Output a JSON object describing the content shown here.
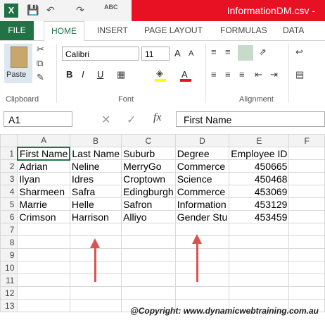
{
  "window": {
    "title": "InformationDM.csv - "
  },
  "qat": {
    "save_icon": "save-icon",
    "undo_icon": "undo-icon",
    "redo_icon": "redo-icon",
    "spell_icon": "spellcheck-icon",
    "spell_label": "ABC"
  },
  "tabs": [
    "FILE",
    "HOME",
    "INSERT",
    "PAGE LAYOUT",
    "FORMULAS",
    "DATA"
  ],
  "ribbon": {
    "clipboard": {
      "paste_label": "Paste",
      "group_label": "Clipboard"
    },
    "font": {
      "name": "Calibri",
      "size": "11",
      "group_label": "Font",
      "bold": "B",
      "italic": "I",
      "underline": "U",
      "grow": "A",
      "shrink": "A"
    },
    "alignment": {
      "group_label": "Alignment"
    }
  },
  "formula_bar": {
    "name_box": "A1",
    "value": "First Name",
    "fx_label": "fx"
  },
  "sheet": {
    "columns": [
      "A",
      "B",
      "C",
      "D",
      "E",
      "F"
    ],
    "rows": [
      [
        "First Name",
        "Last Name",
        "Suburb",
        "Degree",
        "Employee ID",
        ""
      ],
      [
        "Adrian",
        "Neline",
        "MerryGo",
        "Commerce",
        "450665",
        ""
      ],
      [
        "Ilyan",
        "Idres",
        "Croptown",
        "Science",
        "450468",
        ""
      ],
      [
        "Sharmeen",
        "Safra",
        "Edingburgh",
        "Commerce",
        "453069",
        ""
      ],
      [
        "Marrie",
        "Helle",
        "Safron",
        "Information",
        "453129",
        ""
      ],
      [
        "Crimson",
        "Harrison",
        "Alliyo",
        "Gender Stu",
        "453459",
        ""
      ],
      [
        "",
        "",
        "",
        "",
        "",
        ""
      ],
      [
        "",
        "",
        "",
        "",
        "",
        ""
      ],
      [
        "",
        "",
        "",
        "",
        "",
        ""
      ],
      [
        "",
        "",
        "",
        "",
        "",
        ""
      ],
      [
        "",
        "",
        "",
        "",
        "",
        ""
      ],
      [
        "",
        "",
        "",
        "",
        "",
        ""
      ],
      [
        "",
        "",
        "",
        "",
        "",
        ""
      ]
    ],
    "row_numbers": [
      "1",
      "2",
      "3",
      "4",
      "5",
      "6",
      "7",
      "8",
      "9",
      "10",
      "11",
      "12",
      "13"
    ]
  },
  "copyright": "@Copyright: www.dynamicwebtraining.com.au"
}
